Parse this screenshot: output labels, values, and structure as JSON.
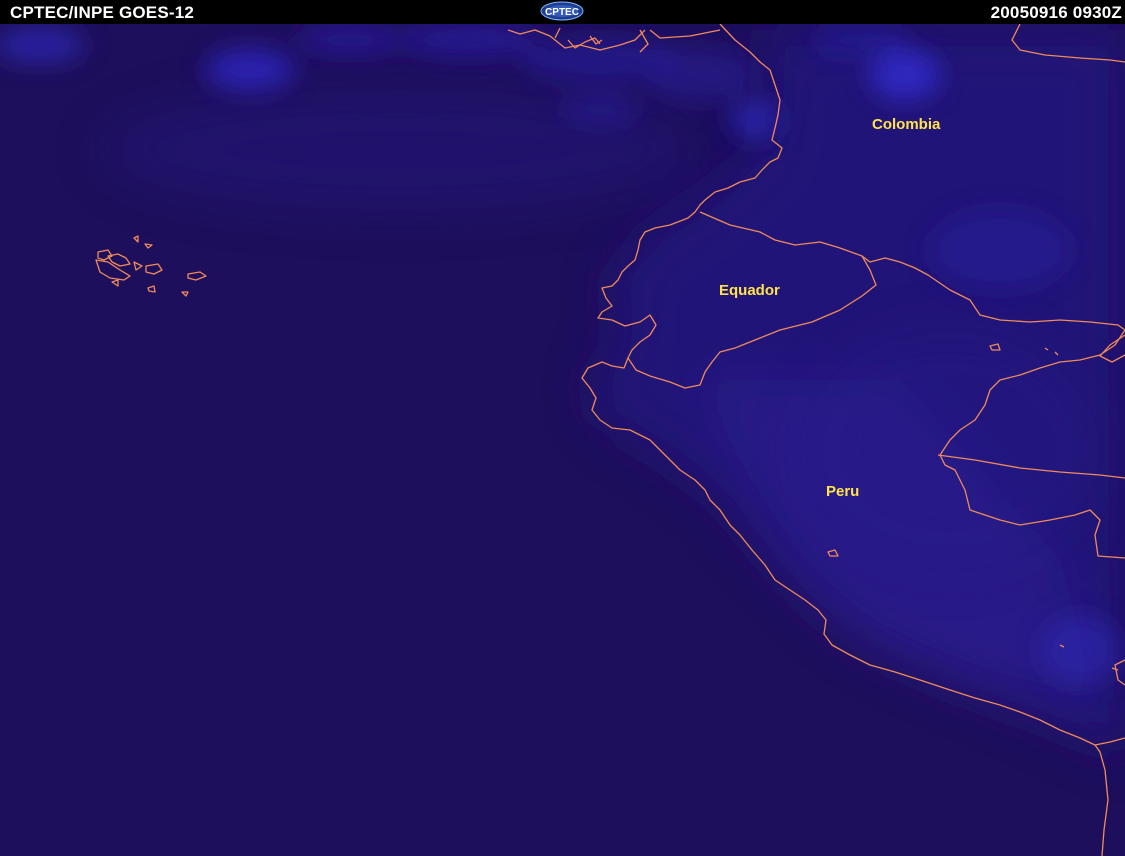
{
  "header": {
    "left_title": "CPTEC/INPE GOES-12",
    "right_timestamp": "20050916  0930Z",
    "logo_text": "CPTEC"
  },
  "map": {
    "labels": {
      "colombia": "Colombia",
      "equador": "Equador",
      "peru": "Peru"
    },
    "colors": {
      "background": "#1e0f5c",
      "cloud": "#2a22a8",
      "land_tint": "#23157a",
      "border": "#f08a5a",
      "label": "#ffe34a"
    }
  }
}
